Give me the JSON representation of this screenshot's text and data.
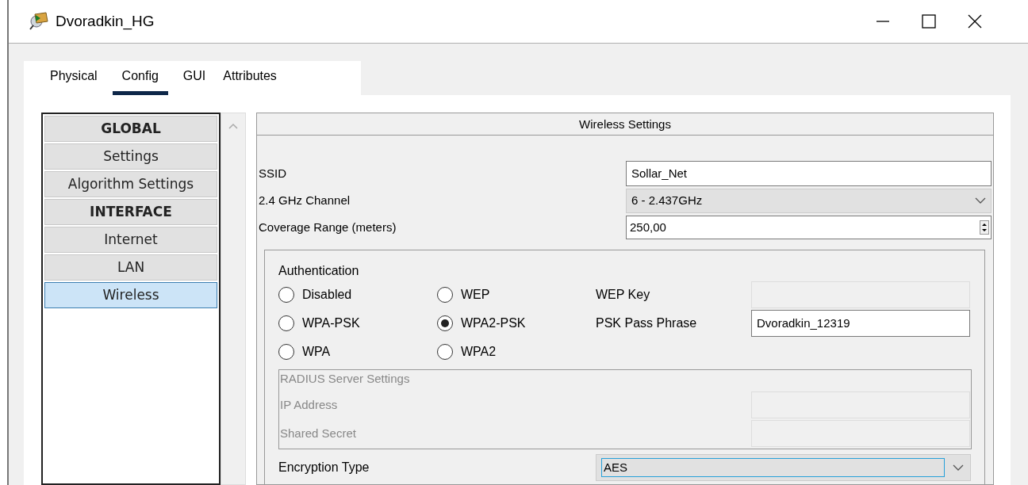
{
  "window": {
    "title": "Dvoradkin_HG"
  },
  "tabs": [
    {
      "label": "Physical",
      "selected": false
    },
    {
      "label": "Config",
      "selected": true
    },
    {
      "label": "GUI",
      "selected": false
    },
    {
      "label": "Attributes",
      "selected": false
    }
  ],
  "sidebar": {
    "items": [
      {
        "label": "GLOBAL",
        "kind": "header",
        "selected": false
      },
      {
        "label": "Settings",
        "kind": "item",
        "selected": false
      },
      {
        "label": "Algorithm Settings",
        "kind": "item",
        "selected": false
      },
      {
        "label": "INTERFACE",
        "kind": "header",
        "selected": false
      },
      {
        "label": "Internet",
        "kind": "item",
        "selected": false
      },
      {
        "label": "LAN",
        "kind": "item",
        "selected": false
      },
      {
        "label": "Wireless",
        "kind": "item",
        "selected": true
      }
    ]
  },
  "wireless_settings": {
    "title": "Wireless Settings",
    "fields": [
      {
        "label": "SSID",
        "kind": "text",
        "value": "Sollar_Net"
      },
      {
        "label": "2.4 GHz Channel",
        "kind": "select",
        "value": "6 - 2.437GHz"
      },
      {
        "label": "Coverage Range (meters)",
        "kind": "spin",
        "value": "250,00"
      }
    ]
  },
  "authentication": {
    "title": "Authentication",
    "options": [
      {
        "label": "Disabled",
        "selected": false
      },
      {
        "label": "WEP",
        "selected": false
      },
      {
        "label": "WPA-PSK",
        "selected": false
      },
      {
        "label": "WPA2-PSK",
        "selected": true
      },
      {
        "label": "WPA",
        "selected": false
      },
      {
        "label": "WPA2",
        "selected": false
      }
    ],
    "keys": [
      {
        "label": "WEP Key",
        "disabled": true
      },
      {
        "label": "PSK Pass Phrase",
        "disabled": false,
        "value": "Dvoradkin_12319"
      }
    ],
    "radius": {
      "title": "RADIUS Server Settings",
      "disabled": true,
      "fields": [
        {
          "label": "IP Address"
        },
        {
          "label": "Shared Secret"
        }
      ]
    },
    "encryption": {
      "label": "Encryption Type",
      "value": "AES"
    }
  }
}
